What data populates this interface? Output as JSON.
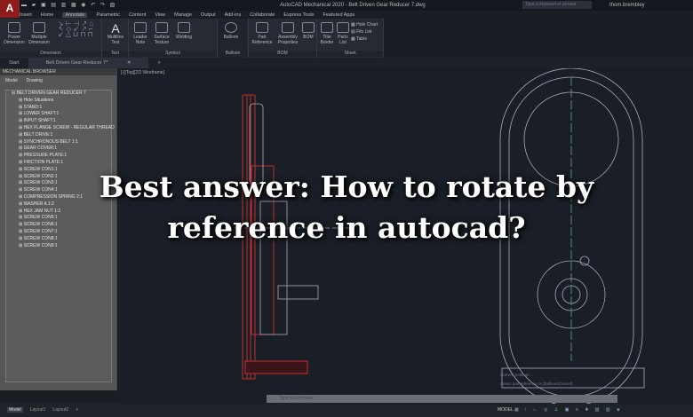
{
  "app": {
    "title": "AutoCAD Mechanical 2020 - Belt Driven Gear Reducer 7.dwg",
    "search_placeholder": "Type a keyword or phrase",
    "user": "thom.brembley"
  },
  "menu_tabs": [
    "Insert",
    "Home",
    "Annotate",
    "Parametric",
    "Content",
    "View",
    "Manage",
    "Output",
    "Add-ins",
    "Collaborate",
    "Express Tools",
    "Featured Apps"
  ],
  "ribbon": {
    "groups": [
      {
        "label": "Dimension",
        "buttons": [
          "Power Dimension",
          "Multiple Dimension"
        ]
      },
      {
        "label": "Text",
        "buttons": [
          "Multiline Text"
        ]
      },
      {
        "label": "Symbol",
        "buttons": [
          "Leader Note",
          "Surface Texture",
          "Welding"
        ]
      },
      {
        "label": "Balloon",
        "buttons": [
          "Balloon"
        ]
      },
      {
        "label": "BOM",
        "buttons": [
          "Part Reference",
          "Assembly Properties",
          "BOM"
        ]
      },
      {
        "label": "Sheet",
        "buttons": [
          "Title Border",
          "Parts List",
          "Hole Chart",
          "Fits List",
          "Table"
        ]
      }
    ]
  },
  "file_tabs": [
    "Start",
    "Belt Driven Gear Reducer 7*"
  ],
  "browser": {
    "title": "MECHANICAL BROWSER",
    "tabs": [
      "Model",
      "Drawing"
    ],
    "items": [
      "BELT DRIVEN GEAR REDUCER 7",
      "Hide Situations",
      "STAND:1",
      "LOWER SHAFT:1",
      "INPUT SHAFT:1",
      "HEX FLANGE SCREW - REGULAR THREAD",
      "BELT DRIVE:1",
      "SYNCHRONOUS BELT 1:1",
      "GEAR COVER:1",
      "PRESSURE PLATE:1",
      "FRICTION PLATE:1",
      "SCREW CON1:1",
      "SCREW CON2:1",
      "SCREW CON3:1",
      "SCREW CON4:1",
      "COMPRESSION SPRING 2:1",
      "WASHER A 1:2",
      "HEX JAM NUT 1:2",
      "SCREW CON5:1",
      "SCREW CON6:1",
      "SCREW CON7:1",
      "SCREW CON8:1",
      "SCREW CON9:1"
    ]
  },
  "viewport": {
    "label": "[-][Top][2D Wireframe]"
  },
  "command": {
    "placeholder": "Type a command",
    "history": [
      "Current Settings: ...",
      "Select part reference or [Balloon/Cancel]:",
      "Command: Cancel"
    ]
  },
  "status": {
    "layout_tabs": [
      "Model",
      "Layout1",
      "Layout2"
    ],
    "mode": "MODEL"
  },
  "overlay": {
    "line1": "Best answer: How to rotate by",
    "line2": "reference in autocad?"
  }
}
